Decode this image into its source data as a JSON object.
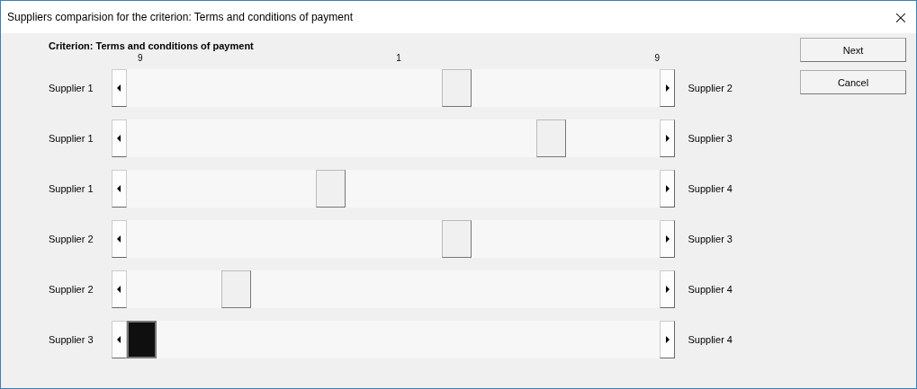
{
  "window": {
    "title": "Suppliers comparision for the criterion: Terms and conditions of payment",
    "close": "×"
  },
  "criterion": "Criterion: Terms and conditions of payment",
  "scale_labels": [
    "9",
    "1",
    "9"
  ],
  "comparisons": [
    {
      "left": "Supplier 1",
      "right": "Supplier 2",
      "level": 0.625,
      "focused": false
    },
    {
      "left": "Supplier 1",
      "right": "Supplier 3",
      "level": 0.8125,
      "focused": false
    },
    {
      "left": "Supplier 1",
      "right": "Supplier 4",
      "level": 0.375,
      "focused": false
    },
    {
      "left": "Supplier 2",
      "right": "Supplier 3",
      "level": 0.625,
      "focused": false
    },
    {
      "left": "Supplier 2",
      "right": "Supplier 4",
      "level": 0.1875,
      "focused": false
    },
    {
      "left": "Supplier 3",
      "right": "Supplier 4",
      "level": 0,
      "focused": true
    }
  ],
  "buttons": [
    "Next",
    "Cancel"
  ]
}
